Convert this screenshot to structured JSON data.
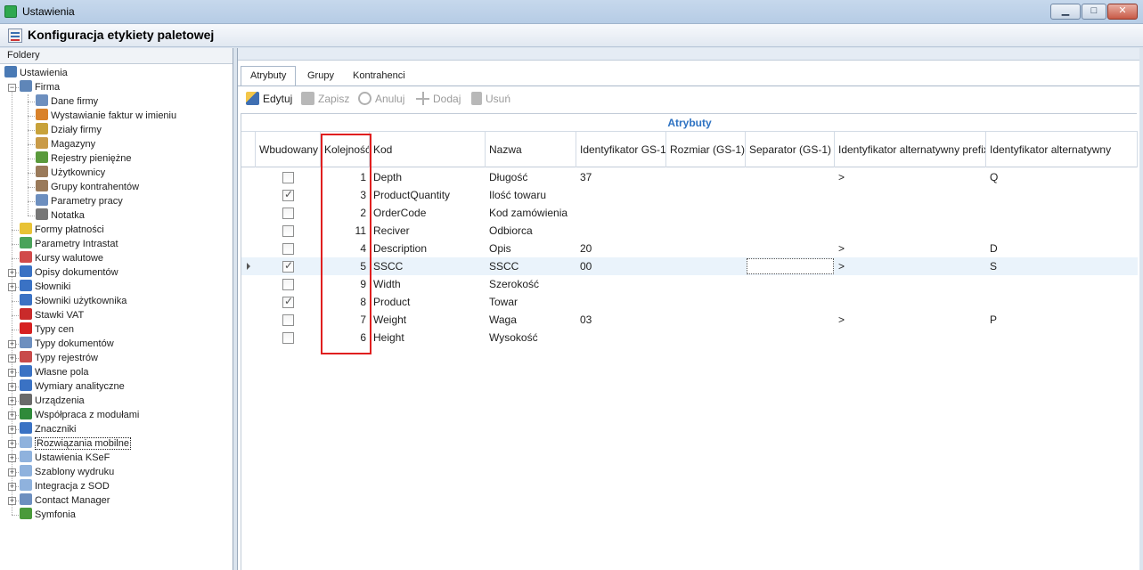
{
  "window": {
    "title": "Ustawienia",
    "controls": [
      "minimize",
      "maximize",
      "close"
    ]
  },
  "header": {
    "title": "Konfiguracja etykiety paletowej"
  },
  "left_panel": {
    "label": "Foldery",
    "tree": [
      {
        "label": "Ustawienia",
        "icon": "tools-icon",
        "level": 0,
        "expander": "",
        "color": "#4a7ab5"
      },
      {
        "label": "Firma",
        "icon": "computer-icon",
        "level": 1,
        "expander": "−",
        "color": "#5f86b8"
      },
      {
        "label": "Dane firmy",
        "icon": "table-icon",
        "level": 2,
        "expander": "",
        "color": "#6d8fbf"
      },
      {
        "label": "Wystawianie faktur w imieniu",
        "icon": "user-icon",
        "level": 2,
        "expander": "",
        "color": "#d9822b"
      },
      {
        "label": "Działy firmy",
        "icon": "departments-icon",
        "level": 2,
        "expander": "",
        "color": "#c8a23a"
      },
      {
        "label": "Magazyny",
        "icon": "warehouse-icon",
        "level": 2,
        "expander": "",
        "color": "#c99b48"
      },
      {
        "label": "Rejestry pieniężne",
        "icon": "money-icon",
        "level": 2,
        "expander": "",
        "color": "#5a9a3c"
      },
      {
        "label": "Użytkownicy",
        "icon": "users-icon",
        "level": 2,
        "expander": "",
        "color": "#9a7a5a"
      },
      {
        "label": "Grupy kontrahentów",
        "icon": "groups-icon",
        "level": 2,
        "expander": "",
        "color": "#9a7a5a"
      },
      {
        "label": "Parametry pracy",
        "icon": "parameters-icon",
        "level": 2,
        "expander": "",
        "color": "#6d8fbf"
      },
      {
        "label": "Notatka",
        "icon": "note-icon",
        "level": 2,
        "expander": "",
        "color": "#777"
      },
      {
        "label": "Formy płatności",
        "icon": "payment-icon",
        "level": 1,
        "expander": "",
        "color": "#e8c235"
      },
      {
        "label": "Parametry Intrastat",
        "icon": "intrastat-icon",
        "level": 1,
        "expander": "",
        "color": "#4aa35a"
      },
      {
        "label": "Kursy walutowe",
        "icon": "currency-chart-icon",
        "level": 1,
        "expander": "",
        "color": "#d14a4a"
      },
      {
        "label": "Opisy dokumentów",
        "icon": "document-icon",
        "level": 1,
        "expander": "+",
        "color": "#3a72c4"
      },
      {
        "label": "Słowniki",
        "icon": "dictionary-icon",
        "level": 1,
        "expander": "+",
        "color": "#3a72c4"
      },
      {
        "label": "Słowniki użytkownika",
        "icon": "user-dictionary-icon",
        "level": 1,
        "expander": "",
        "color": "#3a72c4"
      },
      {
        "label": "Stawki VAT",
        "icon": "vat-icon",
        "level": 1,
        "expander": "",
        "color": "#c92a2a"
      },
      {
        "label": "Typy cen",
        "icon": "price-type-icon",
        "level": 1,
        "expander": "",
        "color": "#d62020"
      },
      {
        "label": "Typy dokumentów",
        "icon": "document-types-icon",
        "level": 1,
        "expander": "+",
        "color": "#6d8fbf"
      },
      {
        "label": "Typy rejestrów",
        "icon": "register-types-icon",
        "level": 1,
        "expander": "+",
        "color": "#c84a4a"
      },
      {
        "label": "Własne pola",
        "icon": "custom-fields-icon",
        "level": 1,
        "expander": "+",
        "color": "#3a72c4"
      },
      {
        "label": "Wymiary analityczne",
        "icon": "dimensions-icon",
        "level": 1,
        "expander": "+",
        "color": "#3a72c4"
      },
      {
        "label": "Urządzenia",
        "icon": "printer-icon",
        "level": 1,
        "expander": "+",
        "color": "#6a6a6a"
      },
      {
        "label": "Współpraca z modułami",
        "icon": "modules-icon",
        "level": 1,
        "expander": "+",
        "color": "#2f8a3a"
      },
      {
        "label": "Znaczniki",
        "icon": "markers-icon",
        "level": 1,
        "expander": "+",
        "color": "#3a72c4"
      },
      {
        "label": "Rozwiązania mobilne",
        "icon": "folder-icon",
        "level": 1,
        "expander": "+",
        "color": "#8fb2dd",
        "selected": true
      },
      {
        "label": "Ustawienia KSeF",
        "icon": "folder-icon",
        "level": 1,
        "expander": "+",
        "color": "#8fb2dd"
      },
      {
        "label": "Szablony wydruku",
        "icon": "folder-icon",
        "level": 1,
        "expander": "+",
        "color": "#8fb2dd"
      },
      {
        "label": "Integracja z SOD",
        "icon": "folder-icon",
        "level": 1,
        "expander": "+",
        "color": "#8fb2dd"
      },
      {
        "label": "Contact Manager",
        "icon": "contact-manager-icon",
        "level": 1,
        "expander": "+",
        "color": "#6d8fbf"
      },
      {
        "label": "Symfonia",
        "icon": "symfonia-icon",
        "level": 1,
        "expander": "",
        "color": "#4a9a3a"
      }
    ]
  },
  "tabs": [
    "Atrybuty",
    "Grupy",
    "Kontrahenci"
  ],
  "active_tab": 0,
  "toolbar": {
    "edit": "Edytuj",
    "save": "Zapisz",
    "cancel": "Anuluj",
    "add": "Dodaj",
    "delete": "Usuń"
  },
  "grid": {
    "caption": "Atrybuty",
    "columns": [
      "Wbudowany",
      "Kolejność",
      "Kod",
      "Nazwa",
      "Identyfikator GS-1",
      "Rozmiar (GS-1)",
      "Separator (GS-1)",
      "Identyfikator alternatywny prefix",
      "Identyfikator alternatywny"
    ],
    "rows": [
      {
        "builtin": false,
        "order": "1",
        "code": "Depth",
        "name": "Długość",
        "gs1": "37",
        "size": "",
        "separator": "",
        "alt_prefix": ">",
        "alt_id": "Q"
      },
      {
        "builtin": true,
        "order": "3",
        "code": "ProductQuantity",
        "name": "Ilość towaru",
        "gs1": "",
        "size": "",
        "separator": "",
        "alt_prefix": "",
        "alt_id": ""
      },
      {
        "builtin": false,
        "order": "2",
        "code": "OrderCode",
        "name": "Kod zamówienia",
        "gs1": "",
        "size": "",
        "separator": "",
        "alt_prefix": "",
        "alt_id": ""
      },
      {
        "builtin": false,
        "order": "11",
        "code": "Reciver",
        "name": "Odbiorca",
        "gs1": "",
        "size": "",
        "separator": "",
        "alt_prefix": "",
        "alt_id": ""
      },
      {
        "builtin": false,
        "order": "4",
        "code": "Description",
        "name": "Opis",
        "gs1": "20",
        "size": "",
        "separator": "",
        "alt_prefix": ">",
        "alt_id": "D"
      },
      {
        "builtin": true,
        "order": "5",
        "code": "SSCC",
        "name": "SSCC",
        "gs1": "00",
        "size": "",
        "separator": "",
        "alt_prefix": ">",
        "alt_id": "S",
        "current": true
      },
      {
        "builtin": false,
        "order": "9",
        "code": "Width",
        "name": "Szerokość",
        "gs1": "",
        "size": "",
        "separator": "",
        "alt_prefix": "",
        "alt_id": ""
      },
      {
        "builtin": true,
        "order": "8",
        "code": "Product",
        "name": "Towar",
        "gs1": "",
        "size": "",
        "separator": "",
        "alt_prefix": "",
        "alt_id": ""
      },
      {
        "builtin": false,
        "order": "7",
        "code": "Weight",
        "name": "Waga",
        "gs1": "03",
        "size": "",
        "separator": "",
        "alt_prefix": ">",
        "alt_id": "P"
      },
      {
        "builtin": false,
        "order": "6",
        "code": "Height",
        "name": "Wysokość",
        "gs1": "",
        "size": "",
        "separator": "",
        "alt_prefix": "",
        "alt_id": ""
      }
    ]
  },
  "colors": {
    "accent": "#2d72c2",
    "highlight": "#e01f1f",
    "current_row": "#eaf3fb"
  }
}
